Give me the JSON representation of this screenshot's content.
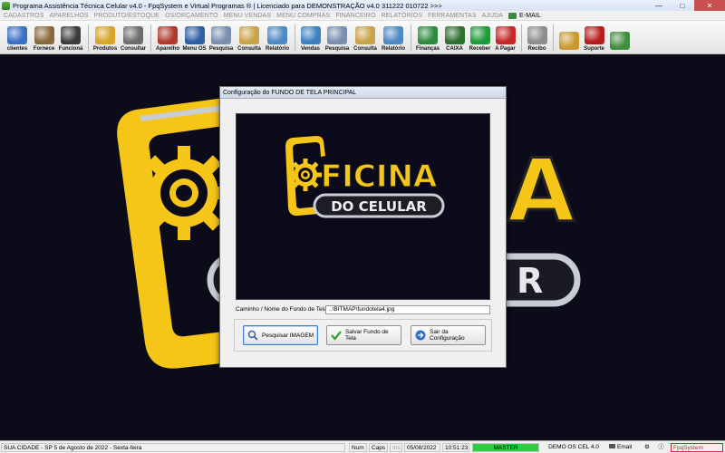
{
  "window": {
    "title": "Programa Assistência Técnica Celular v4.0 - FpqSystem e Virtual Programas ® | Licenciado para  DEMONSTRAÇÃO v4.0 311222 010722 >>>",
    "minimize": "—",
    "maximize": "□",
    "close": "✕"
  },
  "menu": {
    "items": [
      "CADASTROS",
      "APARELHOS",
      "PRODUTO/ESTOQUE",
      "OS/ORÇAMENTO",
      "MENU VENDAS",
      "MENU COMPRAS",
      "FINANCEIRO",
      "RELATÓRIOS",
      "FERRAMENTAS",
      "AJUDA"
    ],
    "email": "E-MAIL"
  },
  "toolbar": {
    "buttons": [
      {
        "label": "clientes",
        "icon": "clients-icon",
        "color": "#3a6fc4"
      },
      {
        "label": "Fornece",
        "icon": "supplier-icon",
        "color": "#8a6a3c"
      },
      {
        "label": "Funcioná",
        "icon": "employee-icon",
        "color": "#3d3d3d"
      },
      {
        "label": "Produtos",
        "icon": "products-icon",
        "color": "#d8a42a"
      },
      {
        "label": "Consultar",
        "icon": "consult-icon",
        "color": "#6d6d6d"
      },
      {
        "label": "Aparelho",
        "icon": "device-icon",
        "color": "#b03a2e"
      },
      {
        "label": "Menu OS",
        "icon": "os-menu-icon",
        "color": "#2d5fa5"
      },
      {
        "label": "Pesquisa",
        "icon": "search-icon",
        "color": "#7b8fb0"
      },
      {
        "label": "Consulta",
        "icon": "consulta-icon",
        "color": "#c9a24a"
      },
      {
        "label": "Relatório",
        "icon": "report-icon",
        "color": "#4d8ac4"
      },
      {
        "label": "Vendas",
        "icon": "sales-icon",
        "color": "#3c7fc2"
      },
      {
        "label": "Pesquisa",
        "icon": "search-sales-icon",
        "color": "#7b8fb0"
      },
      {
        "label": "Consulta",
        "icon": "consulta-sales-icon",
        "color": "#c9a24a"
      },
      {
        "label": "Relatório",
        "icon": "report-sales-icon",
        "color": "#4d8ac4"
      },
      {
        "label": "Finanças",
        "icon": "finance-icon",
        "color": "#2e8b3e"
      },
      {
        "label": "CAIXA",
        "icon": "cash-icon",
        "color": "#2f6f2f"
      },
      {
        "label": "Receber",
        "icon": "receive-icon",
        "color": "#1f9a3a"
      },
      {
        "label": "A Pagar",
        "icon": "pay-icon",
        "color": "#c62828"
      },
      {
        "label": "Recibo",
        "icon": "receipt-icon",
        "color": "#8d8d8d"
      },
      {
        "label": "",
        "icon": "coins-icon",
        "color": "#c99a2e"
      },
      {
        "label": "Suporte",
        "icon": "support-icon",
        "color": "#b71c1c"
      },
      {
        "label": "",
        "icon": "exit-icon",
        "color": "#3e8e3e"
      }
    ]
  },
  "background_logo": {
    "word1": "FICINA",
    "word2": "DO CELULAR"
  },
  "dialog": {
    "title": "Configuração do FUNDO DE TELA PRINCIPAL",
    "path_label": "Caminho / Nome do Fundo de Tela",
    "path_value": "..\\BITMAP\\fundotela4.jpg",
    "buttons": {
      "search": "Pesquisar IMAGEM",
      "save": "Salvar Fundo de Tela",
      "exit": "Sair da Configuração"
    }
  },
  "statusbar": {
    "location": "SUA CIDADE - SP   5 de Agosto de 2022 - Sexta-feira",
    "num": "Num",
    "caps": "Caps",
    "ins": "Ins",
    "date": "05/08/2022",
    "time": "10:51:23",
    "master": "MASTER",
    "version": "DEMO OS CEL 4.0",
    "email": "Email",
    "brand": "FpqSystem"
  },
  "colors": {
    "logo_yellow": "#f5c518",
    "logo_silver": "#c9ccd3",
    "background": "#0b0b1a",
    "status_master": "#2ecc40"
  }
}
